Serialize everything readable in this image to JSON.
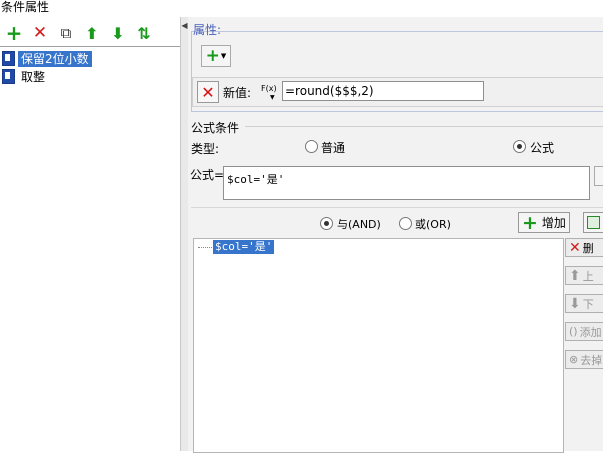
{
  "window": {
    "title": "条件属性"
  },
  "left_toolbar": {
    "buttons": [
      {
        "name": "add",
        "glyph": "+",
        "color": "#1a9a1a"
      },
      {
        "name": "delete",
        "glyph": "✕",
        "color": "#d11a1a"
      },
      {
        "name": "copy",
        "glyph": "⧉",
        "color": "#333333"
      },
      {
        "name": "move-up",
        "glyph": "⬆",
        "color": "#1a9a1a"
      },
      {
        "name": "move-down",
        "glyph": "⬇",
        "color": "#1a9a1a"
      },
      {
        "name": "sort",
        "glyph": "⇅",
        "color": "#1a9a1a"
      }
    ]
  },
  "condition_list": [
    {
      "label": "保留2位小数",
      "selected": true
    },
    {
      "label": "取整",
      "selected": false
    }
  ],
  "properties": {
    "title": "属性:",
    "add_button_glyph": "+",
    "new_value_label": "新值:",
    "fx_label": "F(x)",
    "new_value": "=round($$$,2)"
  },
  "formula_condition": {
    "title": "公式条件",
    "type_label": "类型:",
    "type_options": [
      {
        "label": "普通",
        "checked": false
      },
      {
        "label": "公式",
        "checked": true
      }
    ],
    "formula_label": "公式=",
    "formula_value": "$col='是'"
  },
  "logic": {
    "options": [
      {
        "label": "与(AND)",
        "checked": true
      },
      {
        "label": "或(OR)",
        "checked": false
      }
    ],
    "add_label": "增加"
  },
  "condition_tree": {
    "items": [
      "$col='是'"
    ]
  },
  "side_buttons": [
    {
      "label": "删",
      "glyph": "✕",
      "color": "#d11a1a"
    },
    {
      "label": "上",
      "glyph": "⬆",
      "color": "#999999"
    },
    {
      "label": "下",
      "glyph": "⬇",
      "color": "#999999"
    },
    {
      "label": "添加",
      "glyph": "()",
      "color": "#999999"
    },
    {
      "label": "去掉",
      "glyph": "⊗",
      "color": "#999999"
    }
  ],
  "colors": {
    "accent": "#3774cc",
    "panel": "#f2f2f2"
  }
}
